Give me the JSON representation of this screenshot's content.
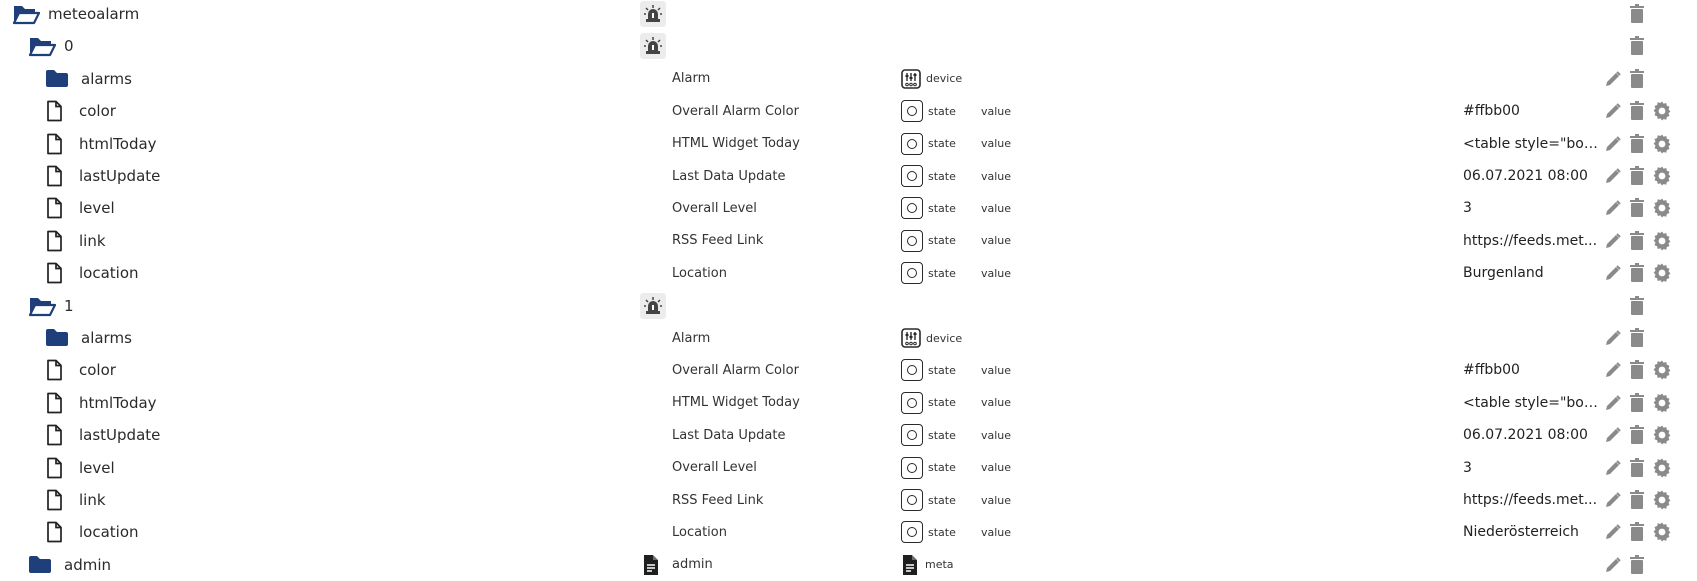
{
  "colors": {
    "folder": "#1e3f7a",
    "action_icon": "#8a8a8a",
    "adapter_bg": "#ececec"
  },
  "rows": [
    {
      "kind": "folder-open",
      "indent": 0,
      "name": "meteoalarm",
      "adapter_icon": true,
      "actions": [
        "delete"
      ]
    },
    {
      "kind": "folder-open",
      "indent": 1,
      "name": "0",
      "adapter_icon": true,
      "actions": [
        "delete"
      ]
    },
    {
      "kind": "folder",
      "indent": 2,
      "name": "alarms",
      "objname": "Alarm",
      "type": "device",
      "type_icon": "device",
      "actions": [
        "edit",
        "delete"
      ]
    },
    {
      "kind": "file",
      "indent": 2,
      "name": "color",
      "objname": "Overall Alarm Color",
      "type": "state",
      "type_icon": "state",
      "role": "value",
      "value": "#ffbb00",
      "actions": [
        "edit",
        "delete",
        "settings"
      ]
    },
    {
      "kind": "file",
      "indent": 2,
      "name": "htmlToday",
      "objname": "HTML Widget Today",
      "type": "state",
      "type_icon": "state",
      "role": "value",
      "value": "<table style=\"bor...",
      "actions": [
        "edit",
        "delete",
        "settings"
      ]
    },
    {
      "kind": "file",
      "indent": 2,
      "name": "lastUpdate",
      "objname": "Last Data Update",
      "type": "state",
      "type_icon": "state",
      "role": "value",
      "value": "06.07.2021 08:00",
      "actions": [
        "edit",
        "delete",
        "settings"
      ]
    },
    {
      "kind": "file",
      "indent": 2,
      "name": "level",
      "objname": "Overall Level",
      "type": "state",
      "type_icon": "state",
      "role": "value",
      "value": "3",
      "actions": [
        "edit",
        "delete",
        "settings"
      ]
    },
    {
      "kind": "file",
      "indent": 2,
      "name": "link",
      "objname": "RSS Feed Link",
      "type": "state",
      "type_icon": "state",
      "role": "value",
      "value": "https://feeds.met...",
      "actions": [
        "edit",
        "delete",
        "settings"
      ]
    },
    {
      "kind": "file",
      "indent": 2,
      "name": "location",
      "objname": "Location",
      "type": "state",
      "type_icon": "state",
      "role": "value",
      "value": "Burgenland",
      "actions": [
        "edit",
        "delete",
        "settings"
      ]
    },
    {
      "kind": "folder-open",
      "indent": 1,
      "name": "1",
      "adapter_icon": true,
      "actions": [
        "delete"
      ]
    },
    {
      "kind": "folder",
      "indent": 2,
      "name": "alarms",
      "objname": "Alarm",
      "type": "device",
      "type_icon": "device",
      "actions": [
        "edit",
        "delete"
      ]
    },
    {
      "kind": "file",
      "indent": 2,
      "name": "color",
      "objname": "Overall Alarm Color",
      "type": "state",
      "type_icon": "state",
      "role": "value",
      "value": "#ffbb00",
      "actions": [
        "edit",
        "delete",
        "settings"
      ]
    },
    {
      "kind": "file",
      "indent": 2,
      "name": "htmlToday",
      "objname": "HTML Widget Today",
      "type": "state",
      "type_icon": "state",
      "role": "value",
      "value": "<table style=\"bor...",
      "actions": [
        "edit",
        "delete",
        "settings"
      ]
    },
    {
      "kind": "file",
      "indent": 2,
      "name": "lastUpdate",
      "objname": "Last Data Update",
      "type": "state",
      "type_icon": "state",
      "role": "value",
      "value": "06.07.2021 08:00",
      "actions": [
        "edit",
        "delete",
        "settings"
      ]
    },
    {
      "kind": "file",
      "indent": 2,
      "name": "level",
      "objname": "Overall Level",
      "type": "state",
      "type_icon": "state",
      "role": "value",
      "value": "3",
      "actions": [
        "edit",
        "delete",
        "settings"
      ]
    },
    {
      "kind": "file",
      "indent": 2,
      "name": "link",
      "objname": "RSS Feed Link",
      "type": "state",
      "type_icon": "state",
      "role": "value",
      "value": "https://feeds.met...",
      "actions": [
        "edit",
        "delete",
        "settings"
      ]
    },
    {
      "kind": "file",
      "indent": 2,
      "name": "location",
      "objname": "Location",
      "type": "state",
      "type_icon": "state",
      "role": "value",
      "value": "Niederösterreich",
      "actions": [
        "edit",
        "delete",
        "settings"
      ]
    },
    {
      "kind": "folder",
      "indent": 1,
      "name": "admin",
      "meta_doc_icon": true,
      "objname": "admin",
      "type": "meta",
      "type_icon": "meta",
      "actions": [
        "edit",
        "delete"
      ]
    }
  ]
}
